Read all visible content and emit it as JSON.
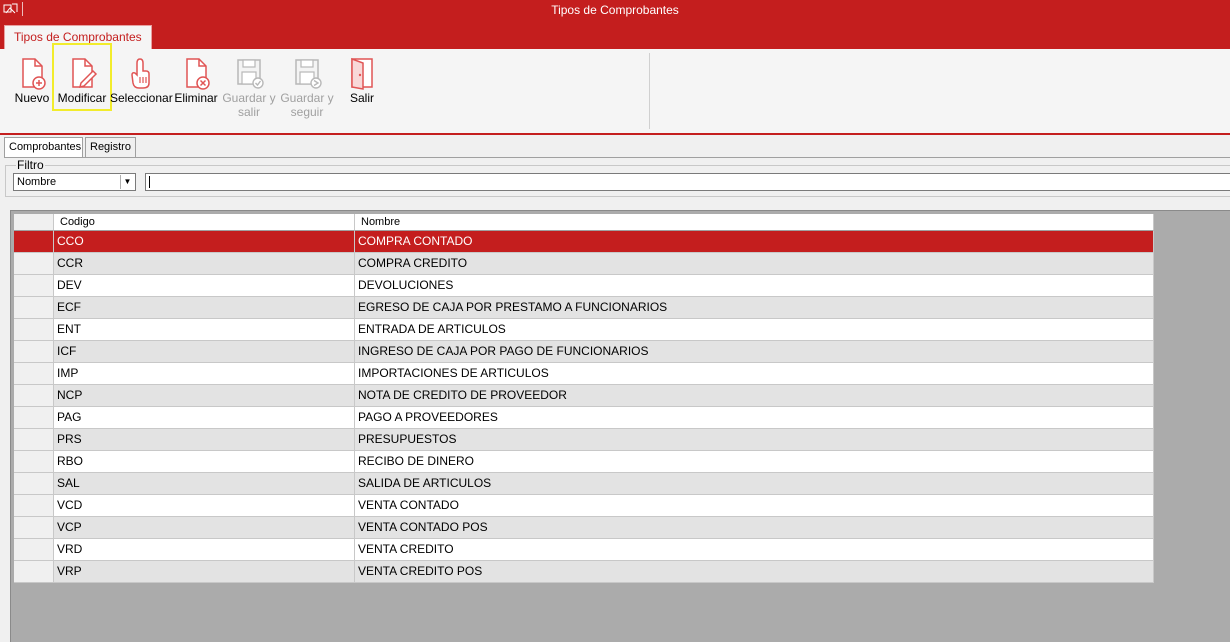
{
  "window": {
    "title": "Tipos de Comprobantes",
    "icon": "app-icon"
  },
  "ribbon": {
    "tab_label": "Tipos de Comprobantes",
    "buttons": {
      "nuevo": "Nuevo",
      "modificar": "Modificar",
      "seleccionar": "Seleccionar",
      "eliminar": "Eliminar",
      "guardar_salir_1": "Guardar y",
      "guardar_salir_2": "salir",
      "guardar_seguir_1": "Guardar y",
      "guardar_seguir_2": "seguir",
      "salir": "Salir"
    }
  },
  "tabs": {
    "comprobantes": "Comprobantes",
    "registro": "Registro"
  },
  "filter": {
    "legend": "Filtro",
    "field_selected": "Nombre",
    "search_value": ""
  },
  "grid": {
    "headers": {
      "code": "Codigo",
      "name": "Nombre"
    },
    "rows": [
      {
        "code": "CCO",
        "name": "COMPRA CONTADO"
      },
      {
        "code": "CCR",
        "name": "COMPRA CREDITO"
      },
      {
        "code": "DEV",
        "name": "DEVOLUCIONES"
      },
      {
        "code": "ECF",
        "name": "EGRESO DE CAJA POR PRESTAMO A FUNCIONARIOS"
      },
      {
        "code": "ENT",
        "name": "ENTRADA DE ARTICULOS"
      },
      {
        "code": "ICF",
        "name": "INGRESO DE CAJA POR PAGO DE FUNCIONARIOS"
      },
      {
        "code": "IMP",
        "name": "IMPORTACIONES DE ARTICULOS"
      },
      {
        "code": "NCP",
        "name": "NOTA DE CREDITO DE PROVEEDOR"
      },
      {
        "code": "PAG",
        "name": "PAGO A PROVEEDORES"
      },
      {
        "code": "PRS",
        "name": "PRESUPUESTOS"
      },
      {
        "code": "RBO",
        "name": "RECIBO DE DINERO"
      },
      {
        "code": "SAL",
        "name": "SALIDA DE ARTICULOS"
      },
      {
        "code": "VCD",
        "name": "VENTA CONTADO"
      },
      {
        "code": "VCP",
        "name": "VENTA CONTADO POS"
      },
      {
        "code": "VRD",
        "name": "VENTA CREDITO"
      },
      {
        "code": "VRP",
        "name": "VENTA CREDITO POS"
      }
    ]
  },
  "colors": {
    "brand_red": "#c41e1e",
    "focus_yellow": "#f2ec2c",
    "row_alt": "#e3e3e3",
    "grid_bg": "#ababab"
  }
}
